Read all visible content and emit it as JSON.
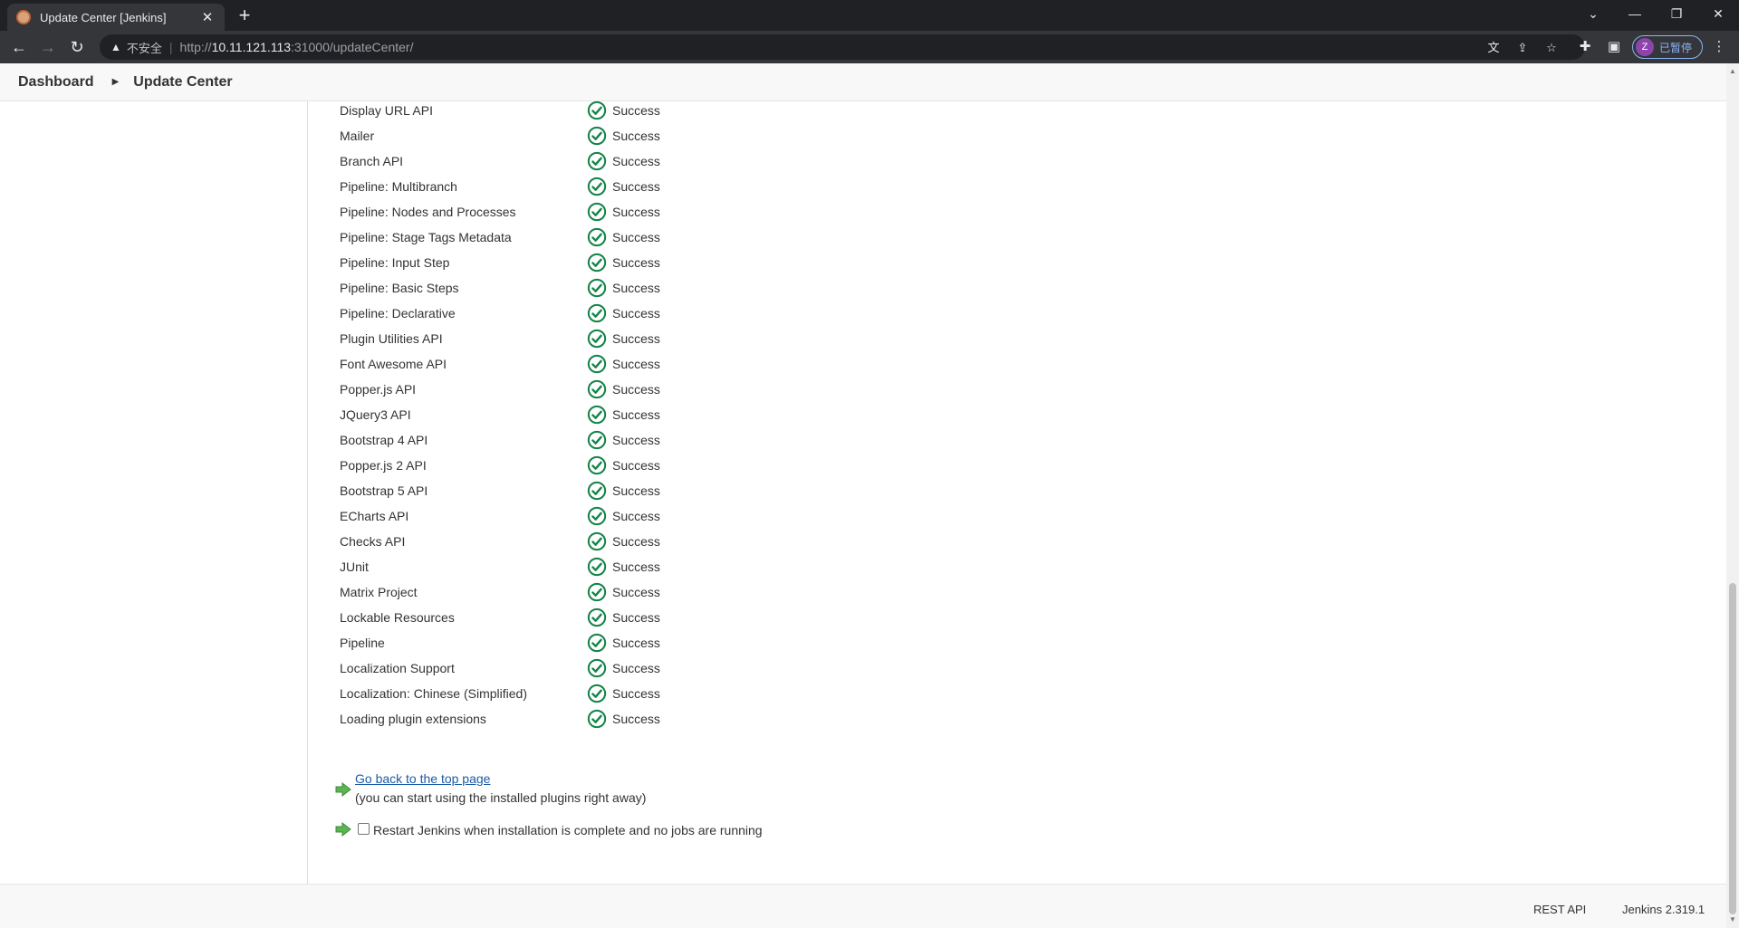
{
  "browser": {
    "tab_title": "Update Center [Jenkins]",
    "insecure_label": "不安全",
    "url_prefix": "http://",
    "url_host": "10.11.121.113",
    "url_rest": ":31000/updateCenter/",
    "profile_initial": "Z",
    "profile_label": "已暂停"
  },
  "breadcrumb": {
    "dashboard": "Dashboard",
    "current": "Update Center"
  },
  "plugins": [
    {
      "name": "Display URL API",
      "status": "Success"
    },
    {
      "name": "Mailer",
      "status": "Success"
    },
    {
      "name": "Branch API",
      "status": "Success"
    },
    {
      "name": "Pipeline: Multibranch",
      "status": "Success"
    },
    {
      "name": "Pipeline: Nodes and Processes",
      "status": "Success"
    },
    {
      "name": "Pipeline: Stage Tags Metadata",
      "status": "Success"
    },
    {
      "name": "Pipeline: Input Step",
      "status": "Success"
    },
    {
      "name": "Pipeline: Basic Steps",
      "status": "Success"
    },
    {
      "name": "Pipeline: Declarative",
      "status": "Success"
    },
    {
      "name": "Plugin Utilities API",
      "status": "Success"
    },
    {
      "name": "Font Awesome API",
      "status": "Success"
    },
    {
      "name": "Popper.js API",
      "status": "Success"
    },
    {
      "name": "JQuery3 API",
      "status": "Success"
    },
    {
      "name": "Bootstrap 4 API",
      "status": "Success"
    },
    {
      "name": "Popper.js 2 API",
      "status": "Success"
    },
    {
      "name": "Bootstrap 5 API",
      "status": "Success"
    },
    {
      "name": "ECharts API",
      "status": "Success"
    },
    {
      "name": "Checks API",
      "status": "Success"
    },
    {
      "name": "JUnit",
      "status": "Success"
    },
    {
      "name": "Matrix Project",
      "status": "Success"
    },
    {
      "name": "Lockable Resources",
      "status": "Success"
    },
    {
      "name": "Pipeline",
      "status": "Success"
    },
    {
      "name": "Localization Support",
      "status": "Success"
    },
    {
      "name": "Localization: Chinese (Simplified)",
      "status": "Success"
    },
    {
      "name": "Loading plugin extensions",
      "status": "Success"
    }
  ],
  "actions": {
    "top_link": "Go back to the top page",
    "top_note": "(you can start using the installed plugins right away)",
    "restart_label": "Restart Jenkins when installation is complete and no jobs are running",
    "restart_checked": false
  },
  "footer": {
    "rest_api": "REST API",
    "version": "Jenkins 2.319.1"
  },
  "colors": {
    "success_green": "#138347",
    "link_blue": "#1a5ba6",
    "arrow_green": "#5ab552"
  },
  "icons": {
    "status": "check-circle-icon",
    "action": "green-arrow-icon"
  }
}
